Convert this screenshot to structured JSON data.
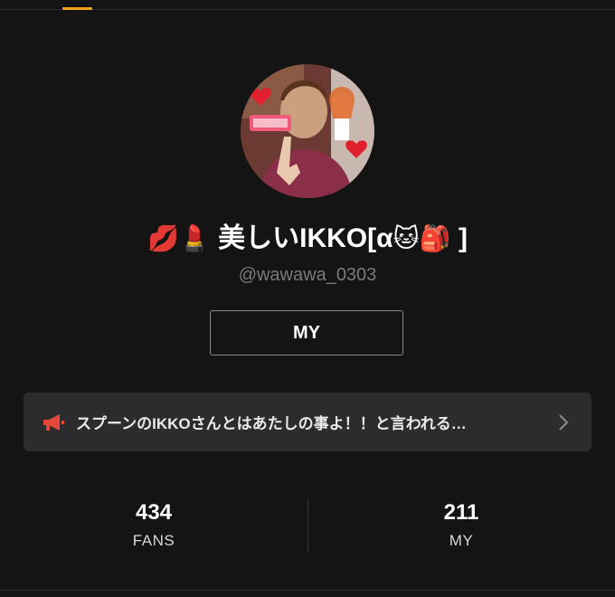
{
  "profile": {
    "display_name_prefix_emojis": "💋💄",
    "display_name_text": "美しいIKKO[α",
    "display_name_suffix_emojis": "🐱🎒",
    "display_name_close": "]",
    "username": "@wawawa_0303",
    "avatar_icon": "profile-photo"
  },
  "action": {
    "my_button_label": "MY"
  },
  "announcement": {
    "icon": "megaphone-icon",
    "text": "スプーンのIKKOさんとはあたしの事よ！！と言われる…",
    "chevron": "chevron-right-icon"
  },
  "stats": {
    "fans_count": "434",
    "fans_label": "FANS",
    "my_count": "211",
    "my_label": "MY"
  },
  "colors": {
    "background": "#141414",
    "accent_tab": "#f3a21b",
    "card": "#2c2c2e",
    "megaphone": "#e2493a"
  }
}
